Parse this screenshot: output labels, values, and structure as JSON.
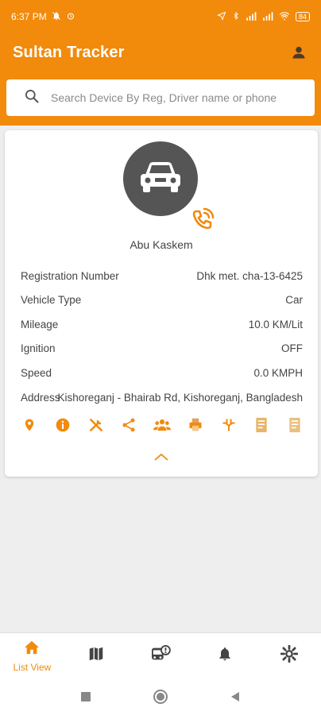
{
  "status_bar": {
    "time": "6:37 PM",
    "battery": "84"
  },
  "app": {
    "title": "Sultan Tracker"
  },
  "search": {
    "placeholder": "Search Device By Reg, Driver name or phone"
  },
  "device": {
    "driver_name": "Abu Kaskem",
    "rows": [
      {
        "label": "Registration Number",
        "value": "Dhk met. cha-13-6425"
      },
      {
        "label": "Vehicle Type",
        "value": "Car"
      },
      {
        "label": "Mileage",
        "value": "10.0 KM/Lit"
      },
      {
        "label": "Ignition",
        "value": "OFF"
      },
      {
        "label": "Speed",
        "value": "0.0 KMPH"
      }
    ],
    "address": {
      "label": "Address",
      "value": "Kishoreganj - Bhairab Rd, Kishoreganj, Bangladesh"
    }
  },
  "actions": [
    "location-pin-icon",
    "info-icon",
    "tools-icon",
    "share-icon",
    "group-icon",
    "printer-icon",
    "route-icon",
    "report-icon",
    "document-icon"
  ],
  "bottom_nav": {
    "list_view_label": "List View"
  },
  "colors": {
    "accent": "#f28a0c",
    "avatar_bg": "#555555"
  }
}
